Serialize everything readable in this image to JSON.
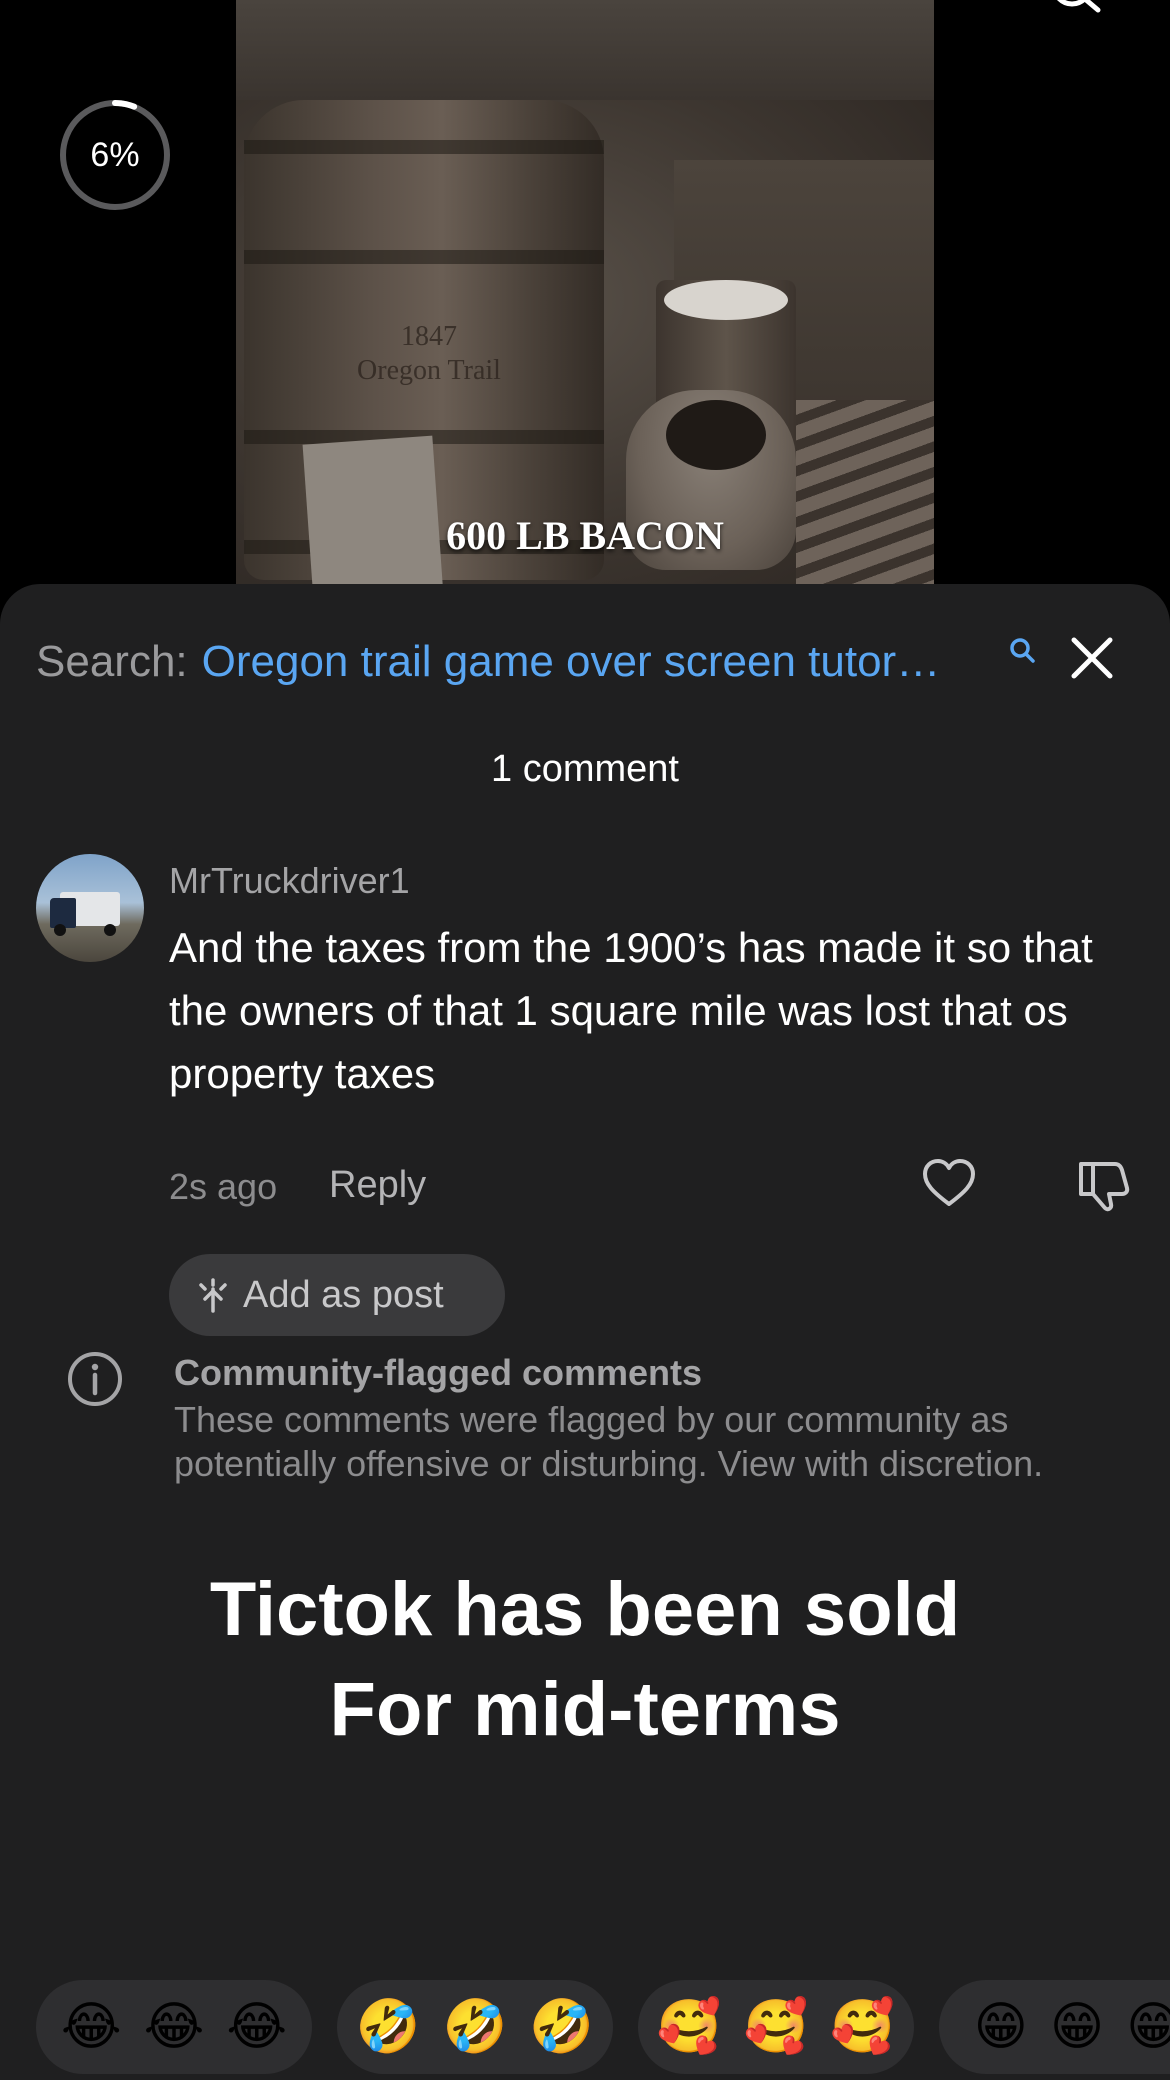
{
  "video": {
    "progress_label": "6%",
    "progress_fraction": 0.06,
    "barrel_text": [
      "1847",
      "Oregon Trail"
    ],
    "caption": "600 LB BACON"
  },
  "search": {
    "prefix": "Search:",
    "query": "Oregon trail game over screen tutor…"
  },
  "comments": {
    "count_label": "1 comment",
    "items": [
      {
        "username": "MrTruckdriver1",
        "text": "And the taxes from the 1900’s has made it so that the owners of that 1 square mile was lost that os property taxes",
        "timestamp": "2s ago",
        "reply_label": "Reply",
        "add_post_label": "Add as post"
      }
    ]
  },
  "flagged": {
    "title": "Community-flagged comments",
    "body": "These comments were flagged by our community as potentially offensive or disturbing. View with discretion."
  },
  "overlay": {
    "line1": "Tictok has been sold",
    "line2": "For mid-terms"
  },
  "emoji_reactions": [
    [
      "😂",
      "😂",
      "😂"
    ],
    [
      "🤣",
      "🤣",
      "🤣"
    ],
    [
      "🥰",
      "🥰",
      "🥰"
    ],
    [
      "😁",
      "😁",
      "😁"
    ]
  ],
  "colors": {
    "sheet_bg": "#1f1f20",
    "link_blue": "#5aa6f2",
    "pill_bg": "#2e2e30"
  }
}
